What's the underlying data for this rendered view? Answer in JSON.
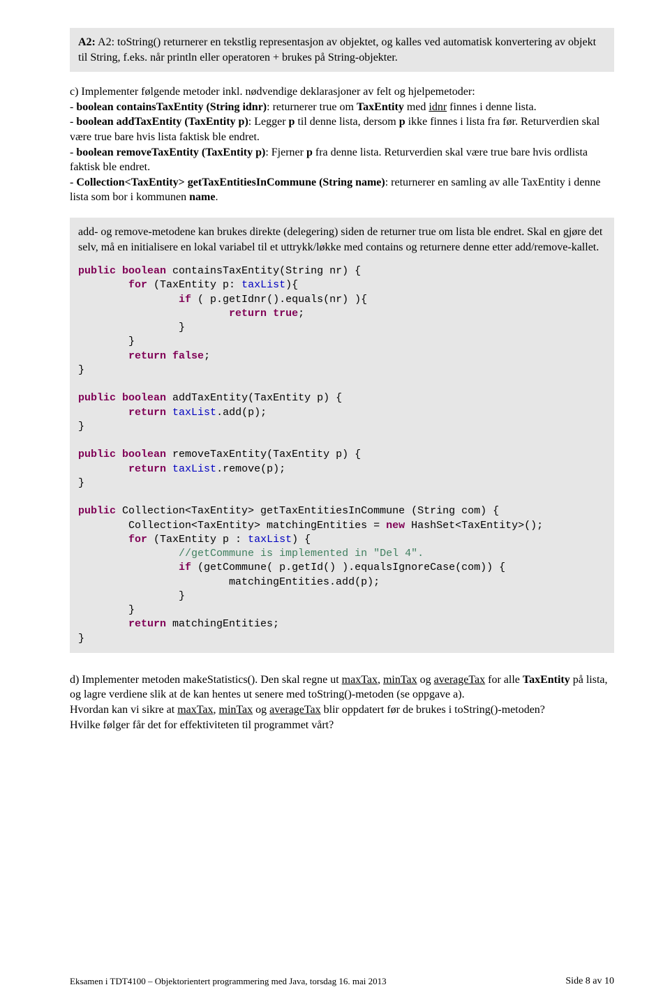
{
  "box1": {
    "content": "A2: toString() returnerer en tekstlig representasjon av objektet, og kalles ved automatisk konvertering av objekt til String, f.eks. når println eller operatoren + brukes på String-objekter."
  },
  "middle1": {
    "p1_a": "c) Implementer følgende metoder inkl. nødvendige deklarasjoner av felt og hjelpemetoder:",
    "p1_b1": "- ",
    "p1_b2": "boolean containsTaxEntity (String idnr)",
    "p1_b3": ": returnerer true om ",
    "p1_b4": "TaxEntity",
    "p1_b5": " med ",
    "p1_b6": "idnr",
    "p1_b7": " finnes i denne lista.",
    "p1_c1": "- ",
    "p1_c2": "boolean addTaxEntity (TaxEntity p)",
    "p1_c3": ": Legger ",
    "p1_c4": "p",
    "p1_c5": " til denne lista, dersom ",
    "p1_c6": "p",
    "p1_c7": " ikke finnes i lista fra før. Returverdien skal være true bare hvis lista faktisk ble endret.",
    "p1_d1": "- ",
    "p1_d2": "boolean removeTaxEntity (TaxEntity p)",
    "p1_d3": ": Fjerner ",
    "p1_d4": "p",
    "p1_d5": " fra denne lista. Returverdien skal være true bare hvis ordlista faktisk ble endret.",
    "p1_e1": "- ",
    "p1_e2": "Collection<TaxEntity> getTaxEntitiesInCommune (String name)",
    "p1_e3": ": returnerer en samling av alle TaxEntity i denne lista som bor i kommunen ",
    "p1_e4": "name",
    "p1_e5": "."
  },
  "box2": {
    "intro": "add- og remove-metodene kan brukes direkte (delegering) siden de returner true om lista ble endret. Skal en gjøre det selv, må en initialisere en lokal variabel til et uttrykk/løkke med contains og returnere denne etter add/remove-kallet.",
    "code": {
      "l1a": "public",
      "l1b": " ",
      "l1c": "boolean",
      "l1d": " containsTaxEntity(String nr) {",
      "l2a": "        ",
      "l2b": "for",
      "l2c": " (TaxEntity p: ",
      "l2d": "taxList",
      "l2e": "){",
      "l3a": "                ",
      "l3b": "if",
      "l3c": " ( p.getIdnr().equals(nr) ){",
      "l4a": "                        ",
      "l4b": "return",
      "l4c": " ",
      "l4d": "true",
      "l4e": ";",
      "l5": "                }",
      "l6": "        }",
      "l7a": "        ",
      "l7b": "return",
      "l7c": " ",
      "l7d": "false",
      "l7e": ";",
      "l8": "}",
      "l9a": "public",
      "l9b": " ",
      "l9c": "boolean",
      "l9d": " addTaxEntity(TaxEntity p) {",
      "l10a": "        ",
      "l10b": "return",
      "l10c": " ",
      "l10d": "taxList",
      "l10e": ".add(p);",
      "l11": "}",
      "l12a": "public",
      "l12b": " ",
      "l12c": "boolean",
      "l12d": " removeTaxEntity(TaxEntity p) {",
      "l13a": "        ",
      "l13b": "return",
      "l13c": " ",
      "l13d": "taxList",
      "l13e": ".remove(p);",
      "l14": "}",
      "l15a": "public",
      "l15b": " Collection<TaxEntity> getTaxEntitiesInCommune (String com) {",
      "l16a": "        Collection<TaxEntity> matchingEntities = ",
      "l16b": "new",
      "l16c": " HashSet<TaxEntity>();",
      "l17a": "        ",
      "l17b": "for",
      "l17c": " (TaxEntity p : ",
      "l17d": "taxList",
      "l17e": ") {",
      "l18a": "                ",
      "l18b": "//getCommune is implemented in \"Del 4\".",
      "l19a": "                ",
      "l19b": "if",
      "l19c": " (getCommune( p.getId() ).equalsIgnoreCase(com)) {",
      "l20": "                        matchingEntities.add(p);",
      "l21": "                }",
      "l22": "        }",
      "l23a": "        ",
      "l23b": "return",
      "l23c": " matchingEntities;",
      "l24": "}"
    }
  },
  "bottom": {
    "p1a": "d) Implementer metoden makeStatistics(). Den skal regne ut ",
    "p1b": "maxTax",
    "p1c": ", ",
    "p1d": "minTax",
    "p1e": " og ",
    "p1f": "averageTax",
    "p1g": " for alle ",
    "p1h": "TaxEntity",
    "p1i": " på lista, og lagre verdiene slik at de kan hentes ut senere med toString()-metoden (se oppgave a).",
    "p2a": "Hvordan kan vi sikre at ",
    "p2b": "maxTax",
    "p2c": ", ",
    "p2d": "minTax",
    "p2e": " og ",
    "p2f": "averageTax",
    "p2g": " blir oppdatert før de brukes i toString()-metoden?",
    "p3": "Hvilke følger får det for effektiviteten til programmet vårt?"
  },
  "footer": {
    "left": "Eksamen i TDT4100 – Objektorientert programmering med Java, torsdag 16. mai 2013",
    "right": "Side 8 av 10"
  }
}
